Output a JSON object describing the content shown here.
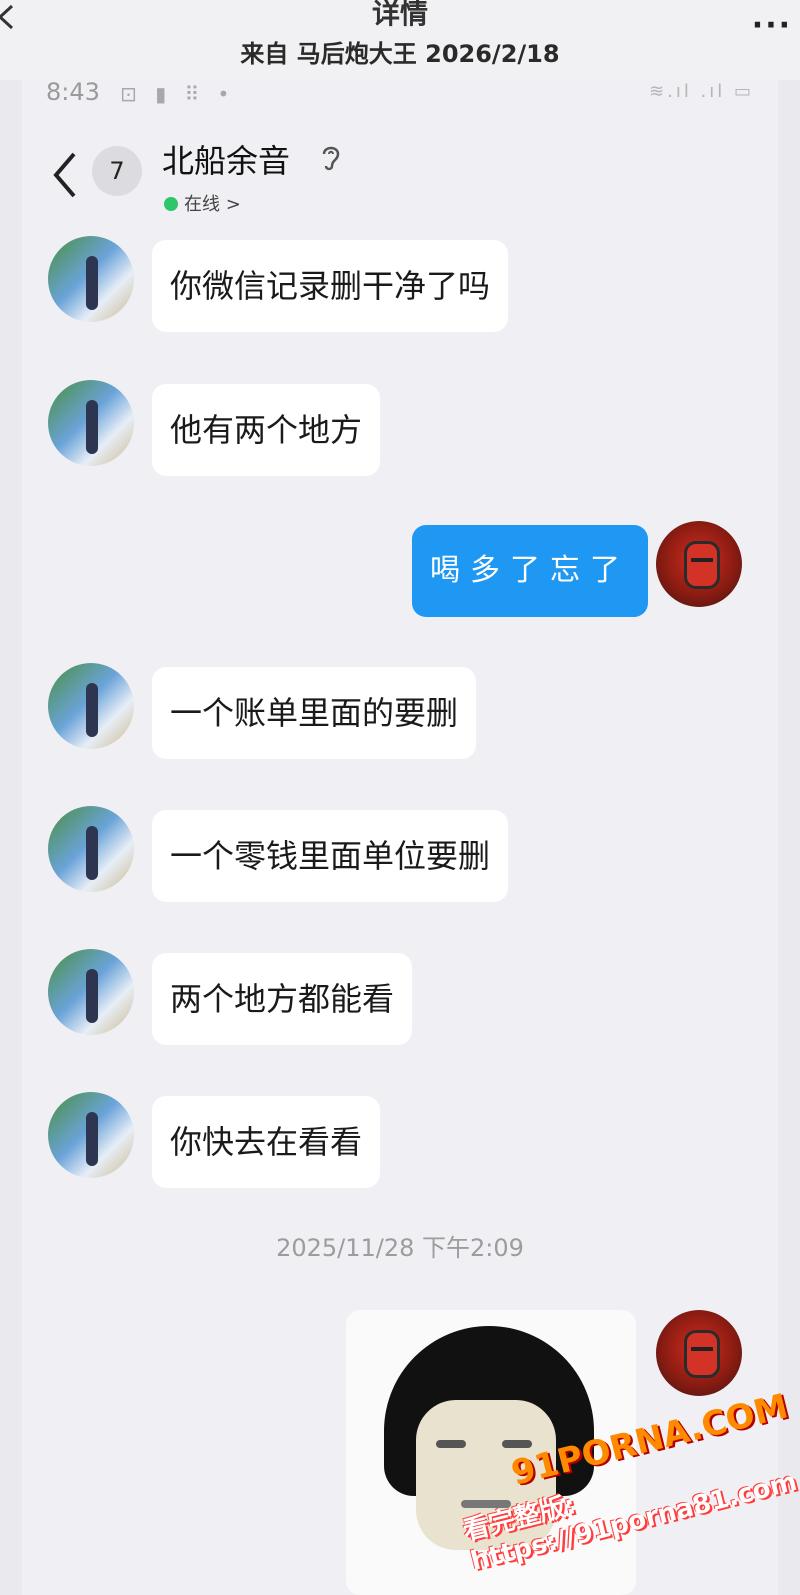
{
  "outer_header": {
    "title": "详情",
    "subtitle": "来自 马后炮大王 2026/2/18",
    "more": "···"
  },
  "status_bar": {
    "time": "8:43",
    "icons": "⊡ ▮ ⠿ •",
    "right": "≋.ıl .ıl ▭"
  },
  "chat_header": {
    "unread_count": "7",
    "contact_name": "北船余音",
    "online_status": "在线 >"
  },
  "messages": [
    {
      "sender": "other",
      "text": "你微信记录删干净了吗"
    },
    {
      "sender": "other",
      "text": "他有两个地方"
    },
    {
      "sender": "me",
      "text": "喝多了忘了"
    },
    {
      "sender": "other",
      "text": "一个账单里面的要删"
    },
    {
      "sender": "other",
      "text": "一个零钱里面单位要删"
    },
    {
      "sender": "other",
      "text": "两个地方都能看"
    },
    {
      "sender": "other",
      "text": "你快去在看看"
    }
  ],
  "timestamp": "2025/11/28 下午2:09",
  "watermark": {
    "logo": "91PORNA.COM",
    "url": "看完整版: https://91porna81.com"
  },
  "colors": {
    "my_bubble": "#1e98f2",
    "other_bubble": "#ffffff",
    "online": "#2fc56b"
  }
}
